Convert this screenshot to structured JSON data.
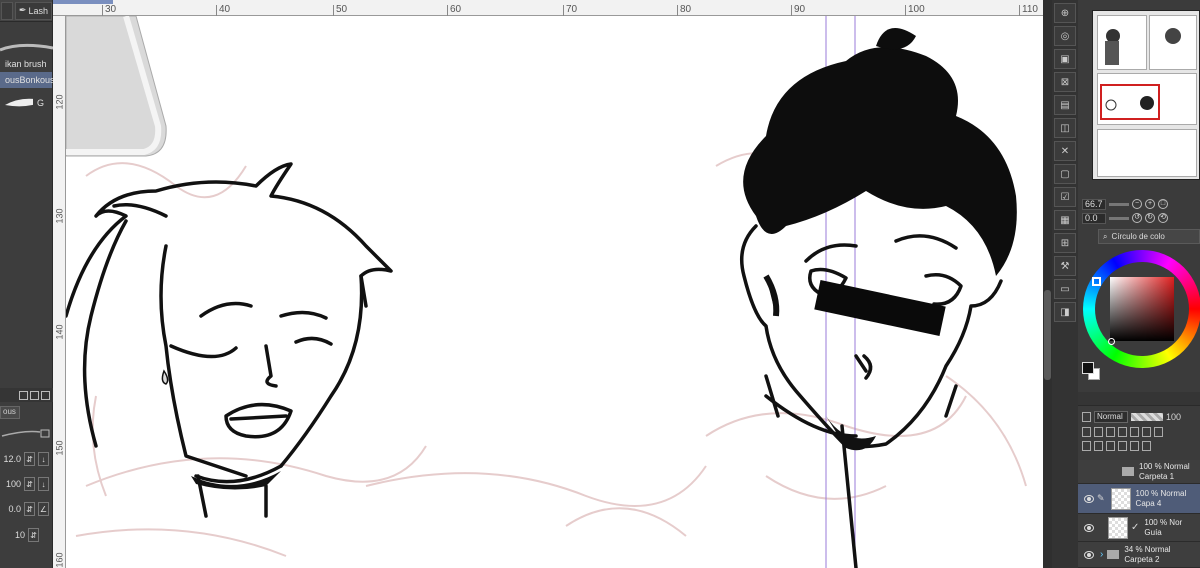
{
  "brush_panel": {
    "tab_label": "Lash",
    "items": [
      {
        "label": "ikan brush"
      },
      {
        "label": "ousBonkous"
      },
      {
        "label": "G"
      }
    ],
    "sub_tab": "ous"
  },
  "tool_settings": {
    "size": "12.0",
    "opacity": "100",
    "param": "0.0",
    "stabilization": "10"
  },
  "ruler": {
    "top_ticks": [
      "30",
      "40",
      "50",
      "60",
      "70",
      "80",
      "90",
      "100",
      "110"
    ],
    "left_ticks": [
      "120",
      "130",
      "140",
      "150",
      "160"
    ]
  },
  "navigator": {
    "zoom": "66.7",
    "rotation": "0.0"
  },
  "color_panel": {
    "tab_label": "Círculo de colo",
    "colors": {
      "hue": "#e02020",
      "foreground": "#111111",
      "background": "#ffffff"
    }
  },
  "layer_panel": {
    "blend_mode": "Normal",
    "opacity": "100",
    "layers": [
      {
        "line1": "100 % Normal",
        "line2": "Carpeta 1",
        "type": "folder",
        "visible": false
      },
      {
        "line1": "100 % Normal",
        "line2": "Capa 4",
        "type": "raster",
        "visible": true,
        "selected": true
      },
      {
        "line1": "100 % Nor",
        "line2": "Guía",
        "type": "guide",
        "visible": true
      },
      {
        "line1": "34 % Normal",
        "line2": "Carpeta 2",
        "type": "folder",
        "visible": true
      }
    ]
  }
}
